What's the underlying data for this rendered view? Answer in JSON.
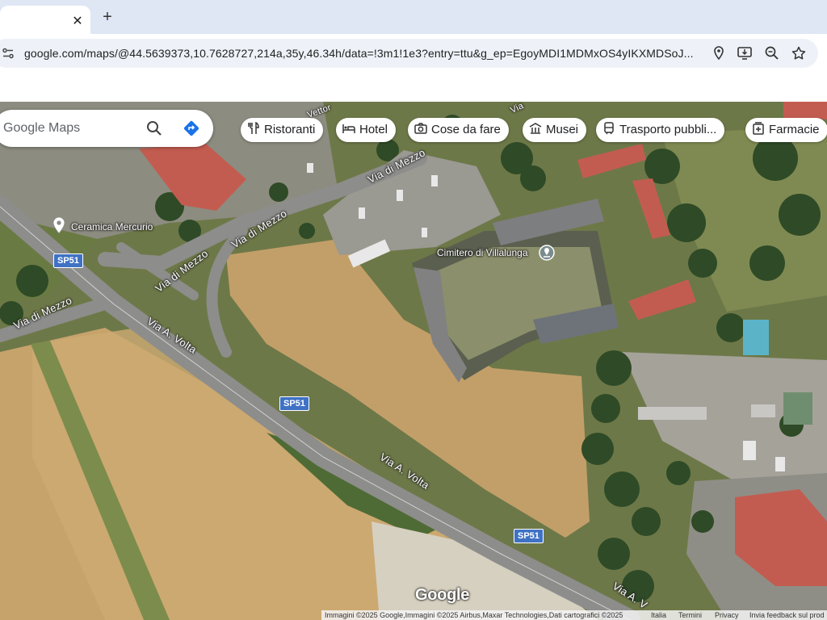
{
  "browser": {
    "tab": {
      "close_glyph": "✕"
    },
    "new_tab_glyph": "+",
    "url": "google.com/maps/@44.5639373,10.7628727,214a,35y,46.34h/data=!3m1!1e3?entry=ttu&g_ep=EgoyMDI1MDMxOS4yIKXMDSoJ...",
    "omnibox_icons": [
      "site-settings-icon",
      "location-icon",
      "install-app-icon",
      "zoom-icon",
      "bookmark-star-icon"
    ]
  },
  "maps": {
    "search_placeholder": "Google Maps",
    "chips": [
      {
        "label": "Ristoranti",
        "icon": "restaurant-icon"
      },
      {
        "label": "Hotel",
        "icon": "hotel-icon"
      },
      {
        "label": "Cose da fare",
        "icon": "camera-icon"
      },
      {
        "label": "Musei",
        "icon": "museum-icon"
      },
      {
        "label": "Trasporto pubbli...",
        "icon": "transit-icon"
      },
      {
        "label": "Farmacie",
        "icon": "pharmacy-icon"
      }
    ],
    "roads": {
      "via_di_mezzo": "Via di Mezzo",
      "via_a_volta": "Via A. Volta",
      "via_a_volta_cut": "Via A. V",
      "sp51": "SP51",
      "top_partial_1": "Vettor",
      "top_partial_2": "Via"
    },
    "places": {
      "ceramica": "Ceramica Mercurio",
      "cimitero": "Cimitero di Villalunga"
    },
    "logo": "Google",
    "attribution": {
      "imagery": "Immagini ©2025 Google,Immagini ©2025 Airbus,Maxar Technologies,Dati cartografici ©2025",
      "italia": "Italia",
      "termini": "Termini",
      "privacy": "Privacy",
      "feedback": "Invia feedback sul prod"
    },
    "colors": {
      "field": "#c9a56d",
      "road": "#8e8e8e",
      "roof_red": "#c05a4e",
      "chip_bg": "#ffffff",
      "shield_blue": "#3f72c4"
    }
  }
}
